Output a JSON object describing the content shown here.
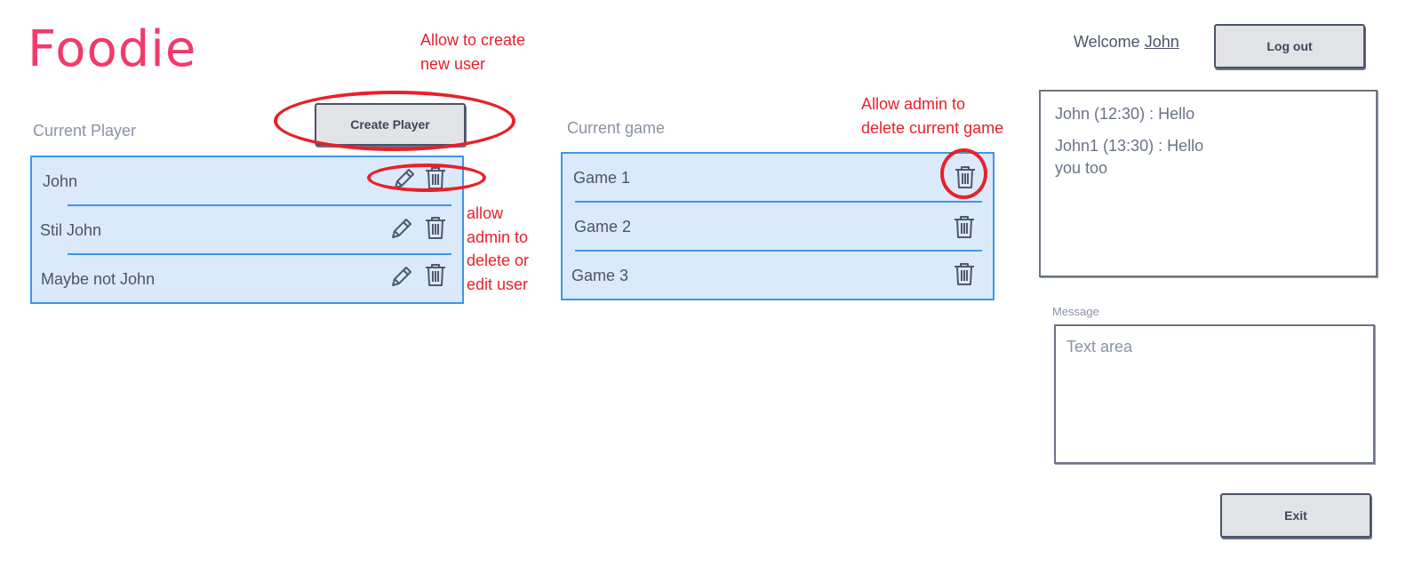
{
  "app": {
    "title": "Foodie"
  },
  "header": {
    "welcome_text": "Welcome",
    "user_name": "John",
    "logout_label": "Log out"
  },
  "players": {
    "section_label": "Current Player",
    "create_label": "Create Player",
    "items": [
      {
        "name": "John"
      },
      {
        "name": "Stil John"
      },
      {
        "name": "Maybe not John"
      }
    ]
  },
  "games": {
    "section_label": "Current game",
    "items": [
      {
        "name": "Game 1"
      },
      {
        "name": "Game 2"
      },
      {
        "name": "Game 3"
      }
    ]
  },
  "chat": {
    "messages": [
      {
        "text": "John (12:30) : Hello"
      },
      {
        "text": "John1 (13:30) : Hello\nyou too"
      }
    ],
    "message_label": "Message",
    "message_placeholder": "Text area",
    "exit_label": "Exit"
  },
  "annotations": {
    "create_user": "Allow to create\nnew user",
    "edit_delete_user": "allow\nadmin to\ndelete or\nedit user",
    "delete_game": "Allow admin to\ndelete current game",
    "color": "#e8202a"
  },
  "icons": {
    "edit": "pencil-icon",
    "delete": "trash-icon"
  },
  "colors": {
    "brand": "#f23a6a",
    "list_bg": "#dbeafb",
    "list_border": "#3f95ea"
  }
}
